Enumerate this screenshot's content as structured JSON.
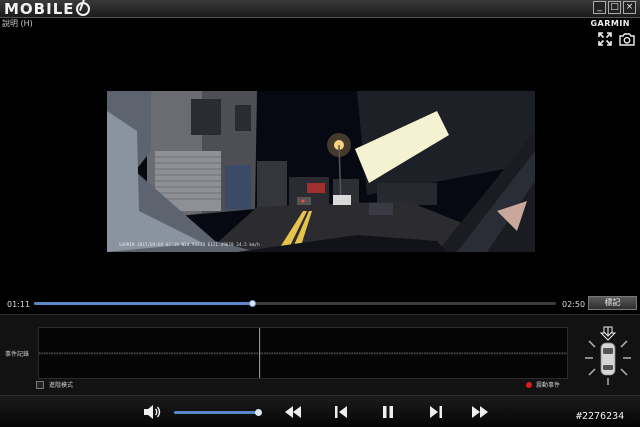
{
  "window": {
    "logo_text": "MOBILE",
    "buttons": [
      "_",
      "□",
      "×"
    ]
  },
  "menu": {
    "item": "說明 (H)"
  },
  "brand": "GARMIN",
  "video": {
    "osd_text": "GARMIN 2017/09/09 07:19 N24.99848 E121.49678 24.5 km/h",
    "colors": {
      "sky": "#070912",
      "road": "#2b2b30",
      "building": "#4d4f55",
      "light": "#f4f2d0"
    }
  },
  "playback": {
    "current_time": "01:11",
    "total_time": "02:50",
    "progress": 0.418,
    "mark_label": "標記"
  },
  "events": {
    "title": "事件記錄",
    "advanced_mode_label": "進階模式",
    "advanced_mode_checked": false,
    "legend_label": "震動事件",
    "legend_color": "#d81f1f",
    "cursor_position": 0.418
  },
  "volume": {
    "level": 0.97
  },
  "controls": [
    "volume-icon",
    "rewind-icon",
    "previous-frame-icon",
    "pause-icon",
    "next-frame-icon",
    "fast-forward-icon"
  ],
  "watermark": "#2276234",
  "accent_color": "#5b86c9"
}
